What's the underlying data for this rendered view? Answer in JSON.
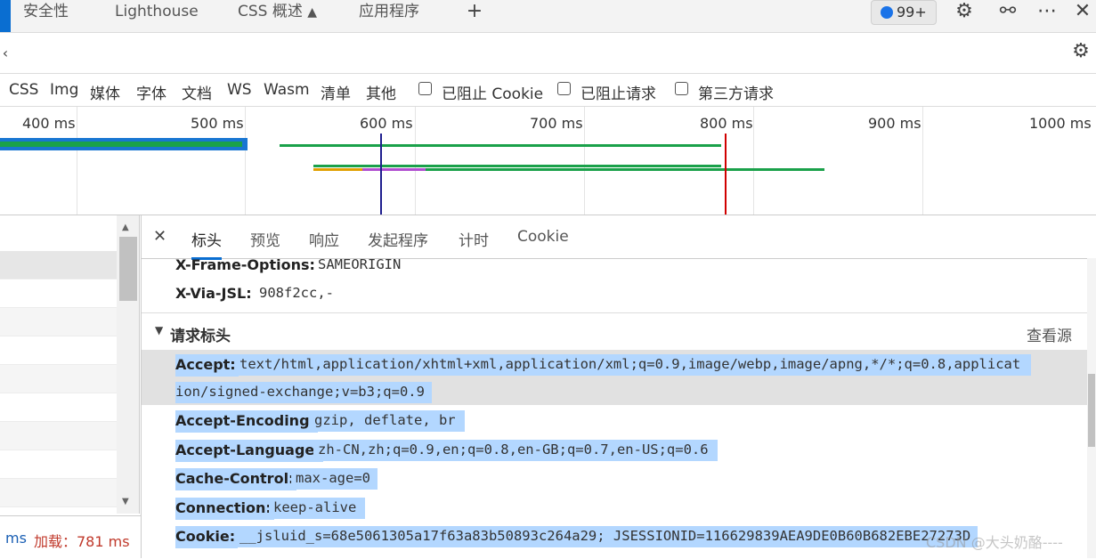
{
  "tabs": [
    {
      "label": "安全性"
    },
    {
      "label": "Lighthouse"
    },
    {
      "label": "CSS 概述"
    },
    {
      "label": "应用程序"
    }
  ],
  "badge": {
    "count": "99+"
  },
  "filters": {
    "types": [
      "CSS",
      "Img",
      "媒体",
      "字体",
      "文档",
      "WS",
      "Wasm",
      "清单",
      "其他"
    ],
    "checkboxes": [
      "已阻止 Cookie",
      "已阻止请求",
      "第三方请求"
    ]
  },
  "timeline": {
    "ticks": [
      "400 ms",
      "500 ms",
      "600 ms",
      "700 ms",
      "800 ms",
      "900 ms",
      "1000 ms"
    ]
  },
  "status": {
    "prefix": "ms",
    "load": "加载：781 ms"
  },
  "details": {
    "tabs": [
      "标头",
      "预览",
      "响应",
      "发起程序",
      "计时",
      "Cookie"
    ],
    "response_headers": [
      {
        "name": "X-Frame-Options:",
        "value": "SAMEORIGIN"
      },
      {
        "name": "X-Via-JSL:",
        "value": "908f2cc,-"
      }
    ],
    "request_section": {
      "title": "请求标头",
      "view_source": "查看源"
    },
    "request_headers": [
      {
        "name": "Accept:",
        "value": "text/html,application/xhtml+xml,application/xml;q=0.9,image/webp,image/apng,*/*;q=0.8,applicat",
        "value2": "ion/signed-exchange;v=b3;q=0.9"
      },
      {
        "name": "Accept-Encoding:",
        "value": "gzip, deflate, br"
      },
      {
        "name": "Accept-Language:",
        "value": "zh-CN,zh;q=0.9,en;q=0.8,en-GB;q=0.7,en-US;q=0.6"
      },
      {
        "name": "Cache-Control:",
        "value": "max-age=0"
      },
      {
        "name": "Connection:",
        "value": "keep-alive"
      },
      {
        "name": "Cookie:",
        "value": "__jsluid_s=68e5061305a17f63a83b50893c264a29; JSESSIONID=116629839AEA9DE0B60B682EBE27273D"
      }
    ]
  },
  "watermark": "CSDN @大头奶酪----",
  "colors": {
    "accent": "#0a6ed1",
    "selection": "#b3d7ff",
    "waterfall_green": "#1aa14a",
    "load_line": "#d00000",
    "dom_line": "#1f1f8f"
  }
}
